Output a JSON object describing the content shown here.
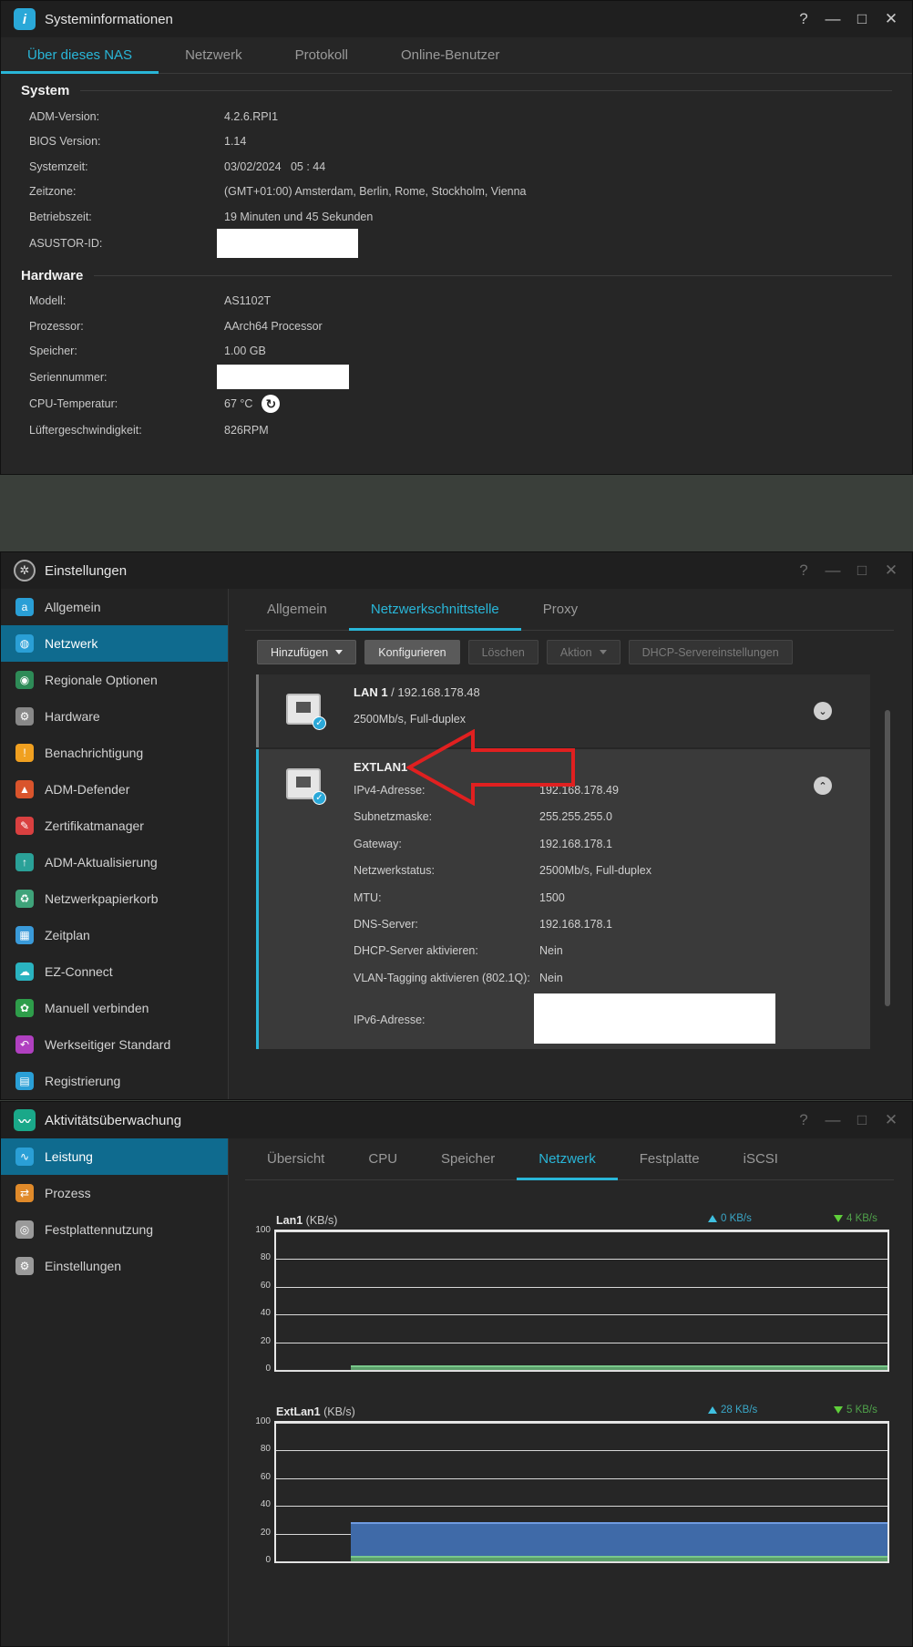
{
  "sysinfo": {
    "title": "Systeminformationen",
    "controls": {
      "help": "?",
      "minimize": "—",
      "maximize": "□",
      "close": "✕"
    },
    "tabs": [
      "Über dieses NAS",
      "Netzwerk",
      "Protokoll",
      "Online-Benutzer"
    ],
    "system_heading": "System",
    "system_rows": [
      {
        "k": "ADM-Version:",
        "v": "4.2.6.RPI1"
      },
      {
        "k": "BIOS Version:",
        "v": "1.14"
      },
      {
        "k": "Systemzeit:",
        "v": "03/02/2024   05 : 44"
      },
      {
        "k": "Zeitzone:",
        "v": "(GMT+01:00) Amsterdam, Berlin, Rome, Stockholm, Vienna"
      },
      {
        "k": "Betriebszeit:",
        "v": "19 Minuten und 45 Sekunden"
      },
      {
        "k": "ASUSTOR-ID:",
        "v": ""
      }
    ],
    "hardware_heading": "Hardware",
    "hardware_rows": [
      {
        "k": "Modell:",
        "v": "AS1102T"
      },
      {
        "k": "Prozessor:",
        "v": "AArch64 Processor"
      },
      {
        "k": "Speicher:",
        "v": "1.00 GB"
      },
      {
        "k": "Seriennummer:",
        "v": ""
      },
      {
        "k": "CPU-Temperatur:",
        "v": "67 °C"
      },
      {
        "k": "Lüftergeschwindigkeit:",
        "v": "826RPM"
      }
    ]
  },
  "settings": {
    "title": "Einstellungen",
    "sidebar": [
      {
        "label": "Allgemein",
        "icon": "general-icon",
        "color": "#2a9fd6"
      },
      {
        "label": "Netzwerk",
        "icon": "globe-icon",
        "color": "#2a9fd6"
      },
      {
        "label": "Regionale Optionen",
        "icon": "region-icon",
        "color": "#2e8b57"
      },
      {
        "label": "Hardware",
        "icon": "hardware-icon",
        "color": "#888888"
      },
      {
        "label": "Benachrichtigung",
        "icon": "notification-icon",
        "color": "#f0a020"
      },
      {
        "label": "ADM-Defender",
        "icon": "defender-icon",
        "color": "#d9542c"
      },
      {
        "label": "Zertifikatmanager",
        "icon": "certificate-icon",
        "color": "#d94040"
      },
      {
        "label": "ADM-Aktualisierung",
        "icon": "update-icon",
        "color": "#2aa198"
      },
      {
        "label": "Netzwerkpapierkorb",
        "icon": "recycle-bin-icon",
        "color": "#3fa37a"
      },
      {
        "label": "Zeitplan",
        "icon": "schedule-icon",
        "color": "#3a9ad9"
      },
      {
        "label": "EZ-Connect",
        "icon": "ez-connect-icon",
        "color": "#2ab3c0"
      },
      {
        "label": "Manuell verbinden",
        "icon": "manual-connect-icon",
        "color": "#2e9d4a"
      },
      {
        "label": "Werkseitiger Standard",
        "icon": "factory-reset-icon",
        "color": "#b040c0"
      },
      {
        "label": "Registrierung",
        "icon": "registration-icon",
        "color": "#2a9fd6"
      }
    ],
    "tabs": [
      "Allgemein",
      "Netzwerkschnittstelle",
      "Proxy"
    ],
    "buttons": {
      "add": "Hinzufügen",
      "configure": "Konfigurieren",
      "delete": "Löschen",
      "action": "Aktion",
      "dhcp": "DHCP-Servereinstellungen"
    },
    "lan1": {
      "name": "LAN 1",
      "ip": " / 192.168.178.48",
      "status": "2500Mb/s, Full-duplex"
    },
    "extlan1": {
      "name": "EXTLAN1",
      "rows": [
        {
          "k": "IPv4-Adresse:",
          "v": "192.168.178.49"
        },
        {
          "k": "Subnetzmaske:",
          "v": "255.255.255.0"
        },
        {
          "k": "Gateway:",
          "v": "192.168.178.1"
        },
        {
          "k": "Netzwerkstatus:",
          "v": "2500Mb/s, Full-duplex"
        },
        {
          "k": "MTU:",
          "v": "1500"
        },
        {
          "k": "DNS-Server:",
          "v": "192.168.178.1"
        },
        {
          "k": "DHCP-Server aktivieren:",
          "v": "Nein"
        },
        {
          "k": "VLAN-Tagging aktivieren (802.1Q):",
          "v": "Nein"
        }
      ],
      "ipv6_label": "IPv6-Adresse:"
    }
  },
  "monitor": {
    "title": "Aktivitätsüberwachung",
    "sidebar": [
      {
        "label": "Leistung",
        "icon": "performance-icon",
        "color": "#2a9fd6"
      },
      {
        "label": "Prozess",
        "icon": "process-icon",
        "color": "#e08a2a"
      },
      {
        "label": "Festplattennutzung",
        "icon": "disk-usage-icon",
        "color": "#9a9a9a"
      },
      {
        "label": "Einstellungen",
        "icon": "settings-gear-icon",
        "color": "#9a9a9a"
      }
    ],
    "tabs": [
      "Übersicht",
      "CPU",
      "Speicher",
      "Netzwerk",
      "Festplatte",
      "iSCSI"
    ],
    "charts": [
      {
        "name": "Lan1",
        "unit": " (KB/s)",
        "up": "0 KB/s",
        "down": "4 KB/s"
      },
      {
        "name": "ExtLan1",
        "unit": " (KB/s)",
        "up": "28 KB/s",
        "down": "5 KB/s"
      }
    ],
    "yticks": [
      "100",
      "80",
      "60",
      "40",
      "20",
      "0"
    ]
  },
  "chart_data": [
    {
      "type": "area",
      "title": "Lan1 (KB/s)",
      "ylim": [
        0,
        100
      ],
      "series": [
        {
          "name": "0 KB/s",
          "values": [
            0
          ]
        },
        {
          "name": "4 KB/s",
          "values": [
            4
          ]
        }
      ]
    },
    {
      "type": "area",
      "title": "ExtLan1 (KB/s)",
      "ylim": [
        0,
        100
      ],
      "series": [
        {
          "name": "28 KB/s",
          "values": [
            28
          ]
        },
        {
          "name": "5 KB/s",
          "values": [
            5
          ]
        }
      ]
    }
  ]
}
